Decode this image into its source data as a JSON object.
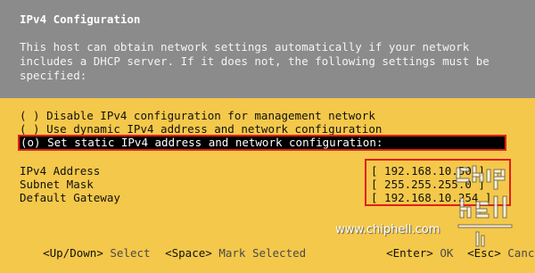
{
  "dialog": {
    "title": "IPv4 Configuration",
    "description_lines": [
      "This host can obtain network settings automatically if your network",
      "includes a DHCP server. If it does not, the following settings must be",
      "specified:"
    ]
  },
  "options": [
    {
      "label": "( ) Disable IPv4 configuration for management network",
      "selected": false
    },
    {
      "label": "( ) Use dynamic IPv4 address and network configuration",
      "selected": false
    },
    {
      "label": "(o) Set static IPv4 address and network configuration:",
      "selected": true
    }
  ],
  "fields": [
    {
      "label": "IPv4 Address",
      "value": "[ 192.168.10.50 ]"
    },
    {
      "label": "Subnet Mask",
      "value": "[ 255.255.255.0 ]"
    },
    {
      "label": "Default Gateway",
      "value": "[ 192.168.10.254 ]"
    }
  ],
  "footer": {
    "updown_key": "<Up/Down>",
    "updown_action": "Select",
    "space_key": "<Space>",
    "space_action": "Mark Selected",
    "enter_key": "<Enter>",
    "enter_action": "OK",
    "esc_key": "<Esc>",
    "esc_action": "Cancel"
  },
  "watermark": {
    "url": "www.chiphell.com",
    "logo_text": "chip hell"
  },
  "colors": {
    "header_gray": "#8b8b8b",
    "body_yellow": "#f4c84a",
    "highlight_red": "#e0201a"
  }
}
